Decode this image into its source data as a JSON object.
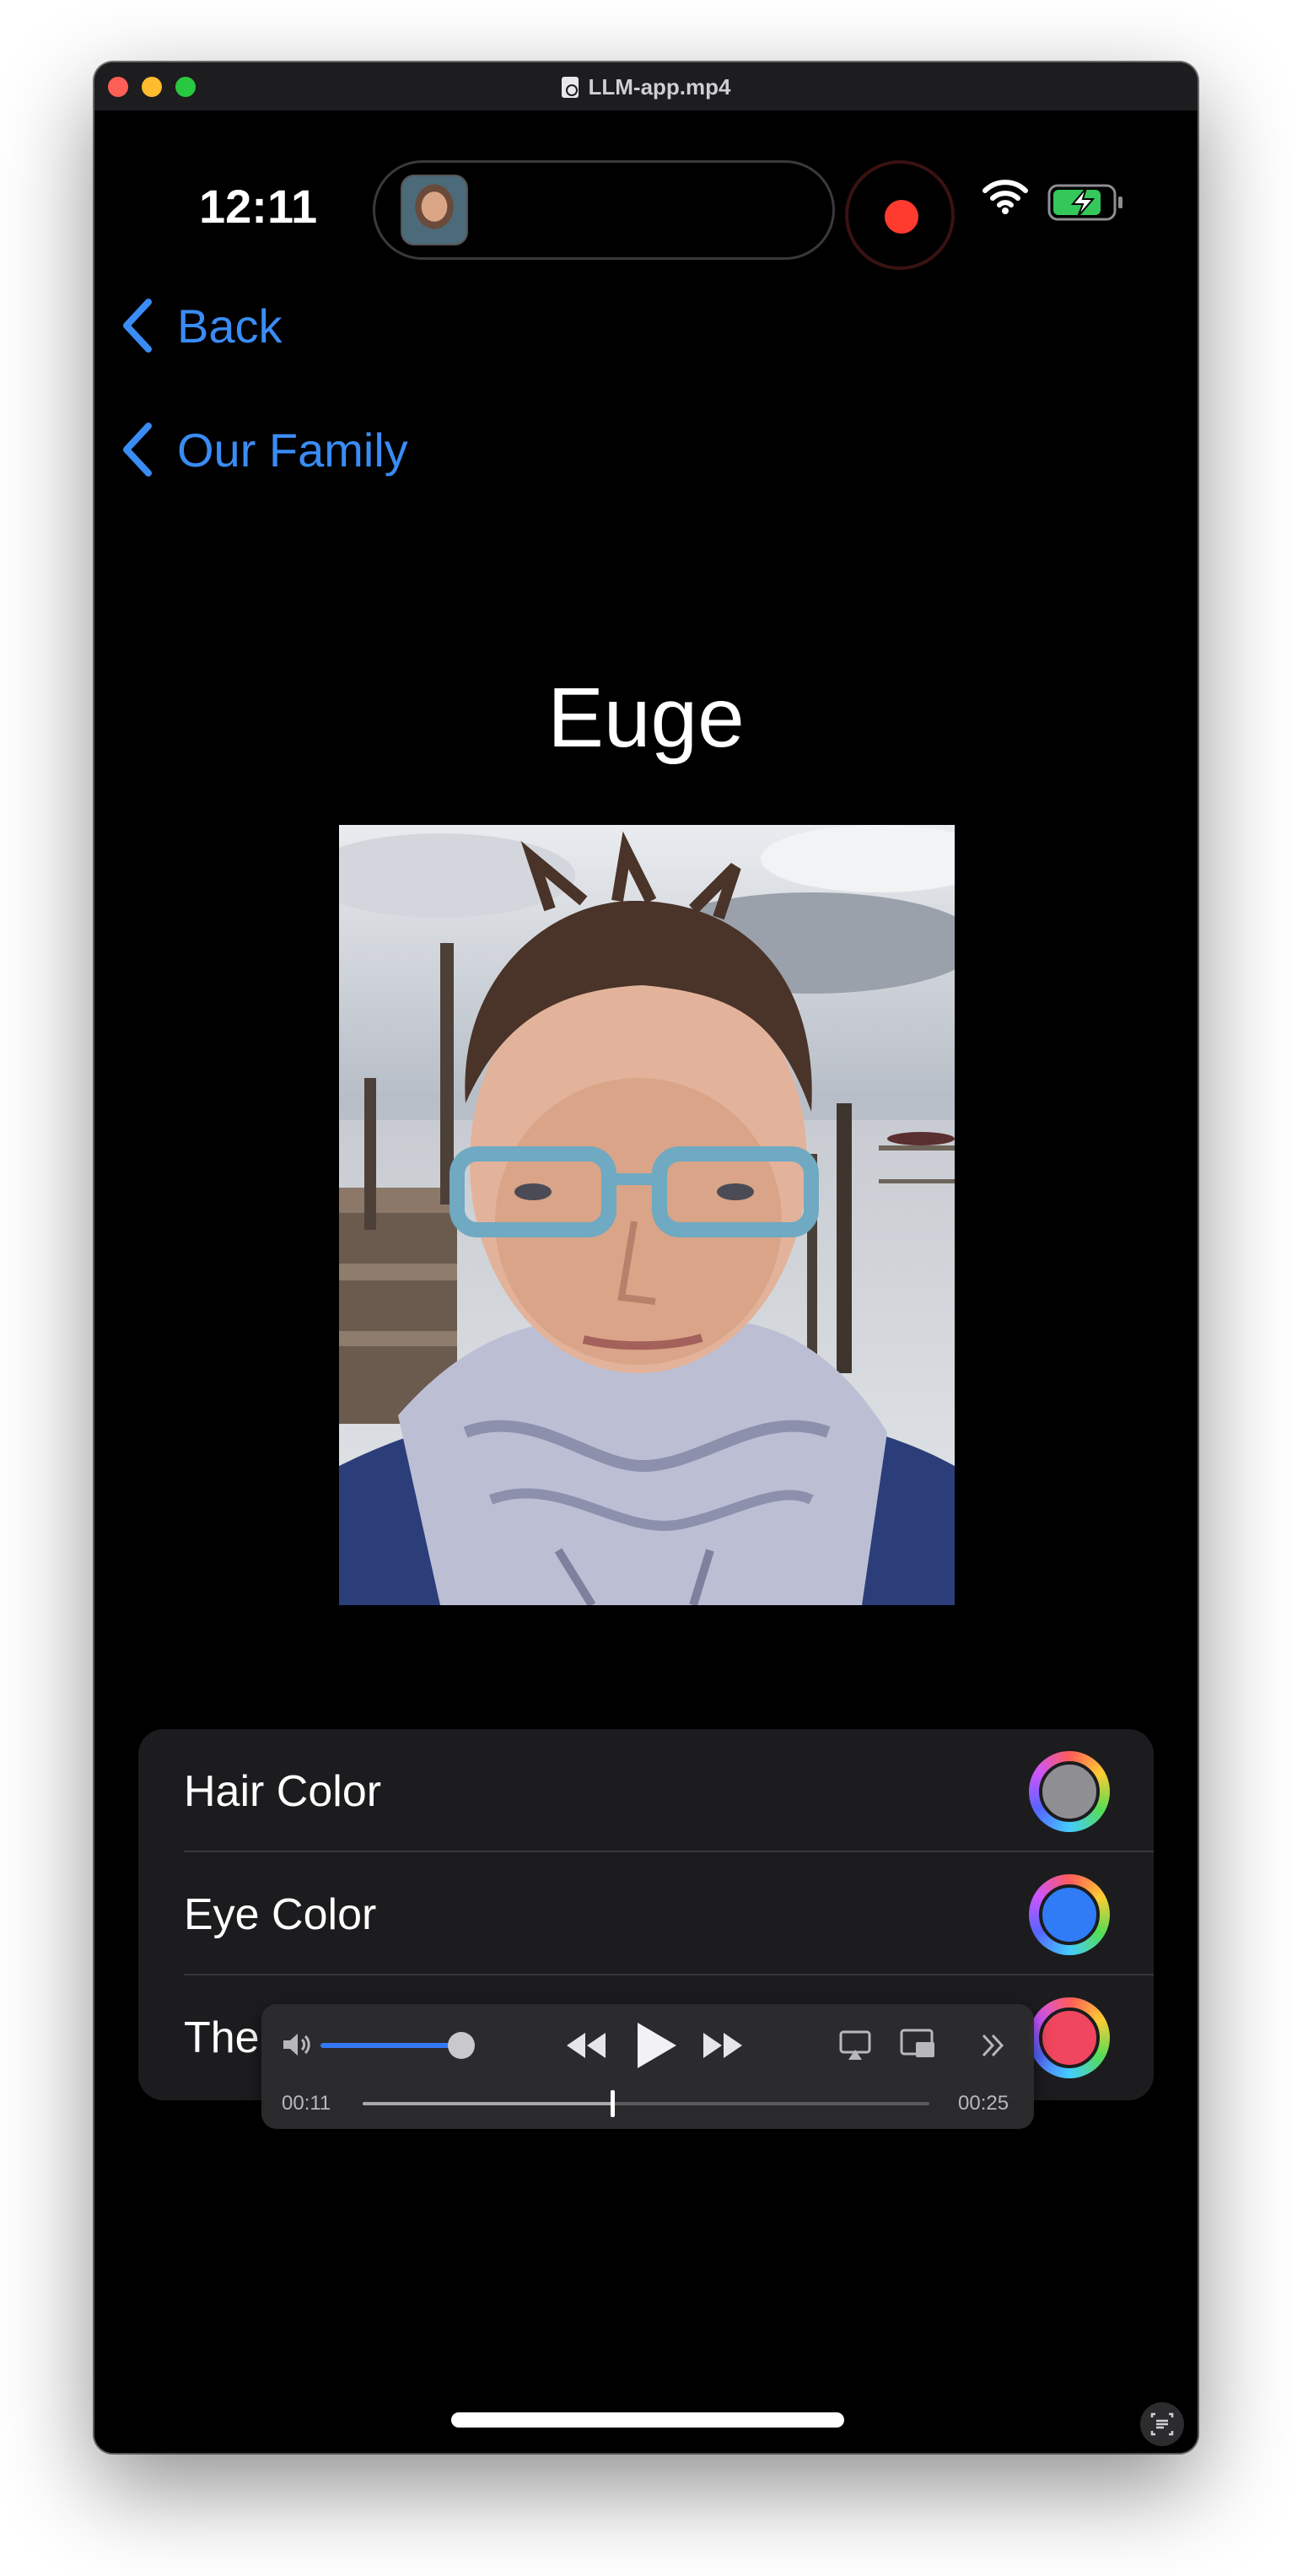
{
  "window": {
    "title": "LLM-app.mp4"
  },
  "status_bar": {
    "time": "12:11",
    "icons": [
      "wifi-icon",
      "battery-charging-icon",
      "screen-recording-icon"
    ]
  },
  "nav": {
    "back_label": "Back",
    "parent_label": "Our Family"
  },
  "person": {
    "name": "Euge"
  },
  "attributes": [
    {
      "label": "Hair Color",
      "color": "#8e8e93"
    },
    {
      "label": "Eye Color",
      "color": "#2f7cf6"
    },
    {
      "label": "The",
      "color": "#f0465f"
    }
  ],
  "player": {
    "current_time": "00:11",
    "duration": "00:25",
    "progress_fraction": 0.44,
    "volume_fraction": 0.88,
    "accent_color": "#3478f6"
  }
}
